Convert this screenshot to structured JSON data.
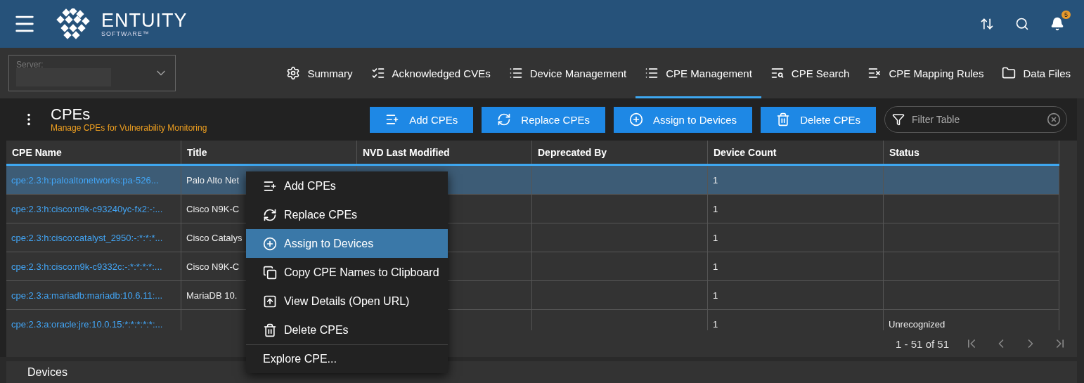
{
  "header": {
    "logo_name": "ENTUITY",
    "logo_sub": "SOFTWARE™",
    "notification_count": "5"
  },
  "server": {
    "label": "Server:"
  },
  "tabs": [
    {
      "label": "Summary",
      "selected": false
    },
    {
      "label": "Acknowledged CVEs",
      "selected": false
    },
    {
      "label": "Device Management",
      "selected": false
    },
    {
      "label": "CPE Management",
      "selected": true
    },
    {
      "label": "CPE Search",
      "selected": false
    },
    {
      "label": "CPE Mapping Rules",
      "selected": false
    },
    {
      "label": "Data Files",
      "selected": false
    }
  ],
  "cpe_panel": {
    "title": "CPEs",
    "subtitle": "Manage CPEs for Vulnerability Monitoring",
    "buttons": [
      "Add CPEs",
      "Replace CPEs",
      "Assign to Devices",
      "Delete CPEs"
    ],
    "filter": {
      "placeholder": "Filter Table"
    },
    "table": {
      "columns": [
        "CPE Name",
        "Title",
        "NVD Last Modified",
        "Deprecated By",
        "Device Count",
        "Status"
      ],
      "rows": [
        {
          "selected": true,
          "cells": [
            "cpe:2.3:h:paloaltonetworks:pa-526...",
            "Palo Alto Net",
            "",
            "",
            "1",
            ""
          ]
        },
        {
          "selected": false,
          "cells": [
            "cpe:2.3:h:cisco:n9k-c93240yc-fx2:-:...",
            "Cisco N9K-C",
            "",
            "",
            "1",
            ""
          ]
        },
        {
          "selected": false,
          "cells": [
            "cpe:2.3:h:cisco:catalyst_2950:-:*:*:*...",
            "Cisco Catalys",
            "",
            "",
            "1",
            ""
          ]
        },
        {
          "selected": false,
          "cells": [
            "cpe:2.3:h:cisco:n9k-c9332c:-:*:*:*:*:...",
            "Cisco N9K-C",
            "",
            "",
            "1",
            ""
          ]
        },
        {
          "selected": false,
          "cells": [
            "cpe:2.3:a:mariadb:mariadb:10.6.11:...",
            "MariaDB 10.",
            "",
            "",
            "1",
            ""
          ]
        },
        {
          "selected": false,
          "cells": [
            "cpe:2.3:a:oracle:jre:10.0.15:*:*:*:*:*:...",
            "",
            "",
            "",
            "1",
            "Unrecognized"
          ]
        }
      ]
    },
    "pagination": "1 - 51 of 51"
  },
  "context_menu": {
    "items": [
      {
        "label": "Add CPEs",
        "selected": false
      },
      {
        "label": "Replace CPEs",
        "selected": false
      },
      {
        "label": "Assign to Devices",
        "selected": true
      },
      {
        "label": "Copy CPE Names to Clipboard",
        "selected": false
      },
      {
        "label": "View Details (Open URL)",
        "selected": false
      },
      {
        "label": "Delete CPEs",
        "selected": false
      },
      {
        "label": "Explore CPE...",
        "selected": false
      }
    ]
  },
  "devices_panel": {
    "title": "Devices"
  }
}
